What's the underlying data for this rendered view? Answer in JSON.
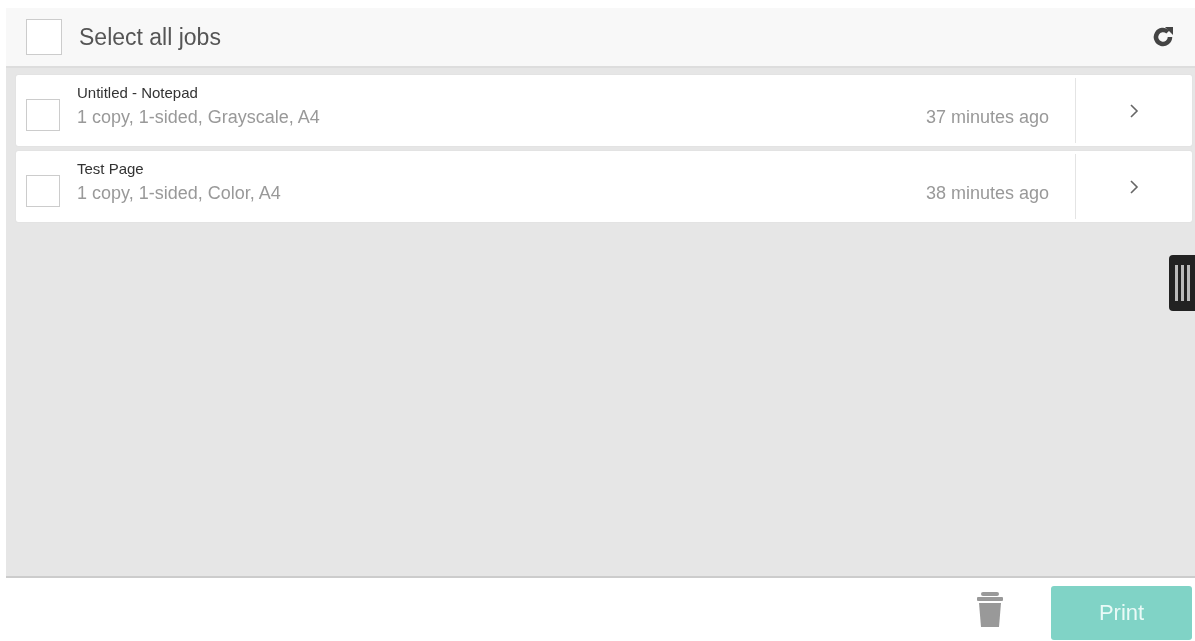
{
  "header": {
    "select_all": {
      "label": "Select all jobs",
      "checked": false
    }
  },
  "jobs": [
    {
      "title": "Untitled - Notepad",
      "details": "1 copy, 1-sided, Grayscale, A4",
      "time": "37 minutes ago",
      "checked": false
    },
    {
      "title": "Test Page",
      "details": "1 copy, 1-sided, Color, A4",
      "time": "38 minutes ago",
      "checked": false
    }
  ],
  "footer": {
    "print_button": {
      "label": "Print",
      "disabled": true
    }
  }
}
